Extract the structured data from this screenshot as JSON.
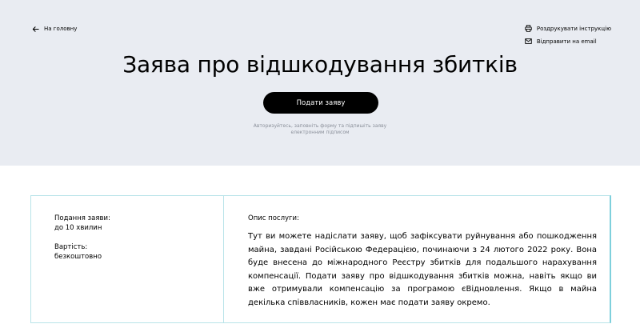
{
  "nav": {
    "back_label": "На головну"
  },
  "actions": {
    "print_label": "Роздрукувати інструкцію",
    "email_label": "Відправити на email"
  },
  "hero": {
    "title": "Заява про відшкодування збитків",
    "submit_label": "Подати заяву",
    "hint": "Авторизуйтесь, заповніть форму та підпишіть заяву електронним підписом",
    "background": "#e9ecf2"
  },
  "info": {
    "duration_label": "Подання заяви:",
    "duration_value": "до 10 хвилин",
    "cost_label": "Вартість:",
    "cost_value": "безкоштовно",
    "description_label": "Опис послуги:",
    "description": "Тут ви можете надіслати заяву, щоб зафіксувати руйнування або пошкодження майна, завдані Російською Федерацією, починаючи з 24 лютого 2022 року. Вона буде внесена до міжнародного Реєстру збитків для подальшого нарахування компенсації. Подати заяву про відшкодування збитків можна, навіть якщо ви вже отримували компенсацію за програмою єВідновлення. Якщо в майна декілька співвласників, кожен має подати заяву окремо.",
    "border_color": "#b9e3e9"
  },
  "icons": {
    "back": "arrow-left-icon",
    "print": "printer-icon",
    "email": "envelope-icon"
  }
}
